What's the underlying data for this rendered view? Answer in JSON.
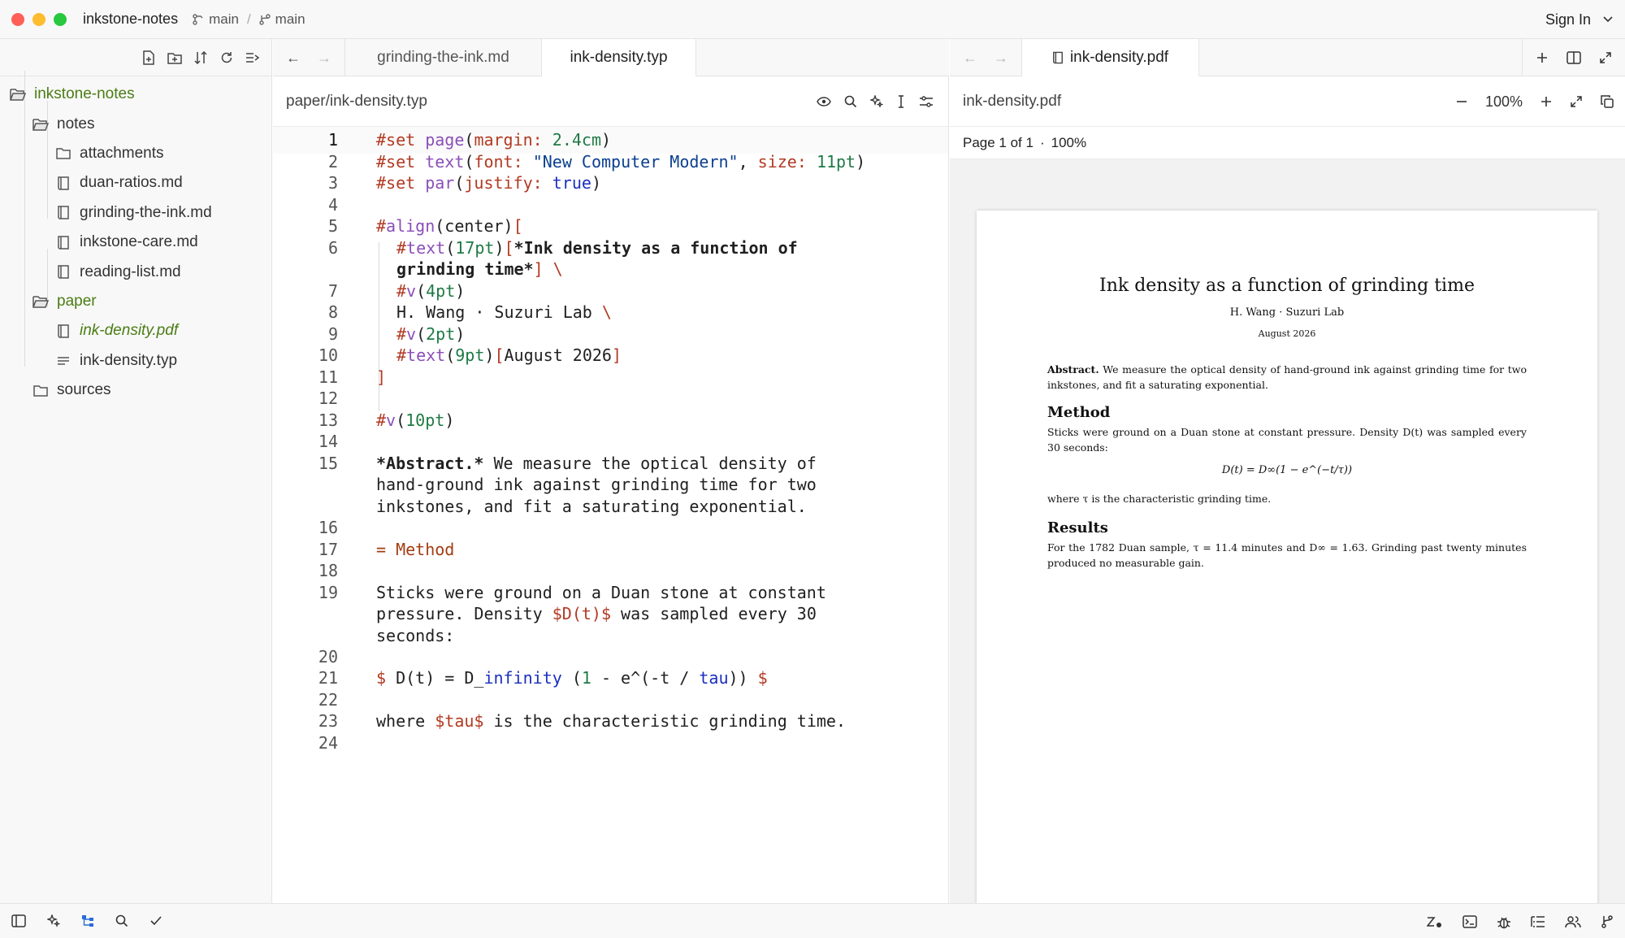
{
  "titlebar": {
    "project": "inkstone-notes",
    "branch1": "main",
    "separator": "/",
    "branch2": "main",
    "sign_in": "Sign In"
  },
  "sidebar": {
    "tree": [
      {
        "label": "inkstone-notes",
        "level": 0,
        "type": "folder-open"
      },
      {
        "label": "notes",
        "level": 1,
        "type": "folder-open"
      },
      {
        "label": "attachments",
        "level": 2,
        "type": "folder"
      },
      {
        "label": "duan-ratios.md",
        "level": 2,
        "type": "book"
      },
      {
        "label": "grinding-the-ink.md",
        "level": 2,
        "type": "book"
      },
      {
        "label": "inkstone-care.md",
        "level": 2,
        "type": "book"
      },
      {
        "label": "reading-list.md",
        "level": 2,
        "type": "book"
      },
      {
        "label": "paper",
        "level": 1,
        "type": "folder-open"
      },
      {
        "label": "ink-density.pdf",
        "level": 2,
        "type": "book"
      },
      {
        "label": "ink-density.typ",
        "level": 2,
        "type": "lines"
      },
      {
        "label": "sources",
        "level": 1,
        "type": "folder"
      }
    ]
  },
  "editor": {
    "tabs": [
      "grinding-the-ink.md",
      "ink-density.typ"
    ],
    "path": "paper/ink-density.typ",
    "line_numbers": [
      "1",
      "2",
      "3",
      "4",
      "5",
      "6",
      "7",
      "8",
      "9",
      "10",
      "11",
      "12",
      "13",
      "14",
      "15",
      "16",
      "17",
      "18",
      "19",
      "20",
      "21",
      "22",
      "23",
      "24"
    ]
  },
  "preview": {
    "tab": "ink-density.pdf",
    "file": "ink-density.pdf",
    "zoom": "100%",
    "page_info": "Page 1 of 1",
    "dot": "·",
    "page_zoom": "100%",
    "paper": {
      "title": "Ink density as a function of grinding time",
      "authors": "H. Wang · Suzuri Lab",
      "date": "August 2026",
      "abstract_label": "Abstract.",
      "abstract": "We measure the optical density of hand-ground ink against grinding time for two inkstones, and fit a saturating exponential.",
      "method_heading": "Method",
      "method_text": "Sticks were ground on a Duan stone at constant pressure. Density D(t) was sampled every 30 seconds:",
      "equation": "D(t) = D∞(1 − e^(−t/τ))",
      "where_text": "where τ is the characteristic grinding time.",
      "results_heading": "Results",
      "results_text": "For the 1782 Duan sample, τ = 11.4 minutes and D∞ = 1.63. Grinding past twenty minutes produced no measurable gain."
    }
  }
}
